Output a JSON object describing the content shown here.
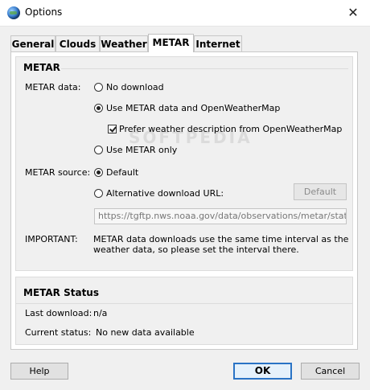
{
  "window": {
    "title": "Options",
    "close_glyph": "✕"
  },
  "tabs": [
    {
      "label": "General",
      "active": false
    },
    {
      "label": "Clouds",
      "active": false
    },
    {
      "label": "Weather",
      "active": false
    },
    {
      "label": "METAR",
      "active": true
    },
    {
      "label": "Internet",
      "active": false
    }
  ],
  "metar": {
    "section_title": "METAR",
    "data_label": "METAR data:",
    "options": {
      "no_download": {
        "label": "No download",
        "selected": false
      },
      "use_metar_owm": {
        "label": "Use METAR data and OpenWeatherMap",
        "selected": true
      },
      "prefer_owm": {
        "label": "Prefer weather description from OpenWeatherMap",
        "checked": true
      },
      "use_metar_only": {
        "label": "Use METAR only",
        "selected": false
      }
    },
    "source_label": "METAR source:",
    "source": {
      "default": {
        "label": "Default",
        "selected": true
      },
      "alternative": {
        "label": "Alternative download URL:",
        "selected": false
      },
      "default_button": "Default",
      "url": "https://tgftp.nws.noaa.gov/data/observations/metar/stations/"
    },
    "important_label": "IMPORTANT:",
    "important_text_line1": "METAR data downloads use the same time interval as the",
    "important_text_line2": "weather data, so please set the interval there."
  },
  "status": {
    "section_title": "METAR Status",
    "last_download_label": "Last download:",
    "last_download_value": "n/a",
    "current_status_label": "Current status:",
    "current_status_value": "No new data available"
  },
  "buttons": {
    "help": "Help",
    "ok": "OK",
    "cancel": "Cancel"
  },
  "watermark": "SOFTPEDIA",
  "colors": {
    "accent": "#2a73c5",
    "panel_bg": "#f0f0f0"
  }
}
